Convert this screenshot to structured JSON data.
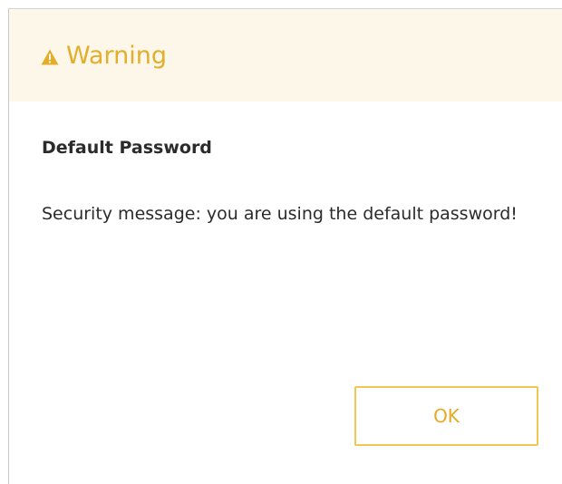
{
  "dialog": {
    "title": "Warning",
    "icon": "warning-triangle-icon",
    "heading": "Default Password",
    "message": "Security message: you are using the default password!",
    "ok_label": "OK",
    "colors": {
      "header_background": "#fcf7e8",
      "accent": "#e2ae2c",
      "button_border": "#f2c653",
      "text": "#2b2b2b"
    }
  }
}
